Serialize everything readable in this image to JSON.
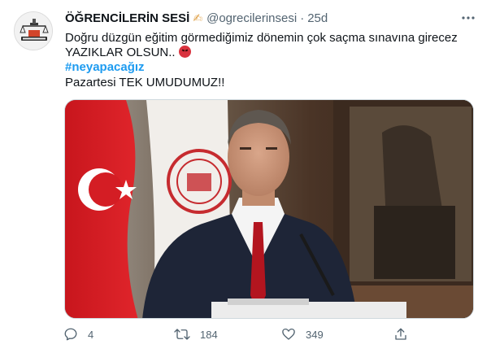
{
  "tweet": {
    "avatar_icon": "school-logo-icon",
    "display_name": "ÖĞRENCİLERİN SESİ",
    "name_emoji": "✍",
    "handle": "@ogrecilerinsesi",
    "separator": "·",
    "time": "25d",
    "text_line1": "Doğru düzgün eğitim görmediğimiz dönemin çok saçma sınavına girecez",
    "text_line2": "YAZIKLAR OLSUN..",
    "hashtag": "#neyapacağız",
    "text_line4": "Pazartesi TEK UMUDUMUZ!!",
    "hashtag_color": "#1d9bf0"
  },
  "actions": {
    "reply_count": "4",
    "retweet_count": "184",
    "like_count": "349"
  }
}
